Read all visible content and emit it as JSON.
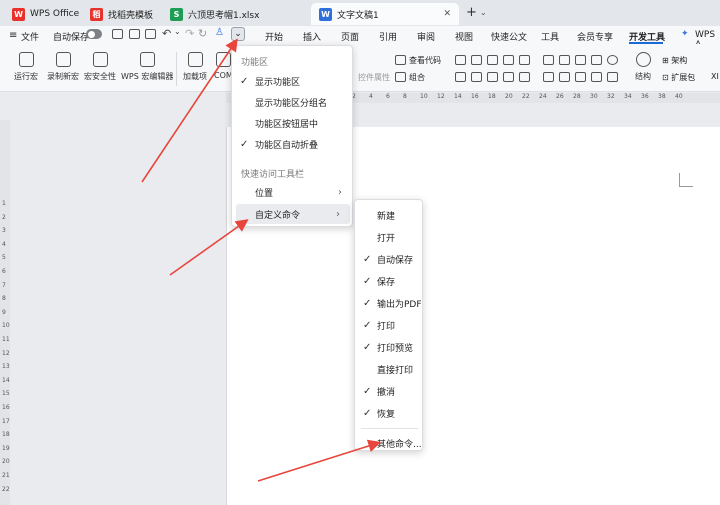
{
  "tabs": [
    {
      "label": "WPS Office",
      "icon": "wps-logo-icon",
      "color": "#e8312b"
    },
    {
      "label": "找稻壳模板",
      "icon": "docer-icon",
      "color": "#e8312b"
    },
    {
      "label": "六顶思考帽1.xlsx",
      "icon": "spreadsheet-icon",
      "color": "#1e9e55"
    },
    {
      "label": "文字文稿1",
      "icon": "writer-icon",
      "color": "#2f6fdb"
    }
  ],
  "new_tab": "+",
  "toolbar": {
    "file": "文件",
    "autosave": "自动保存"
  },
  "menu_tabs": [
    "开始",
    "插入",
    "页面",
    "引用",
    "审阅",
    "视图",
    "快速公文",
    "工具",
    "会员专享",
    "开发工具",
    "WPS A"
  ],
  "active_menu_tab": "开发工具",
  "ribbon": {
    "run_macro": "运行宏",
    "record_macro": "录制新宏",
    "macro_security": "宏安全性",
    "vba_editor": "WPS 宏编辑器",
    "addins": "加载项",
    "com": "COM",
    "control_props": "控件属性",
    "view_code": "查看代码",
    "combine": "组合",
    "structure": "结构",
    "arch": "架构",
    "ext_pack": "扩展包",
    "xml": "XI"
  },
  "dropdown1": {
    "section1": "功能区",
    "items": [
      {
        "label": "显示功能区",
        "checked": true
      },
      {
        "label": "显示功能区分组名",
        "checked": false
      },
      {
        "label": "功能区按钮居中",
        "checked": false
      },
      {
        "label": "功能区自动折叠",
        "checked": true
      }
    ],
    "section2": "快速访问工具栏",
    "position": "位置",
    "custom": "自定义命令"
  },
  "dropdown2": {
    "items": [
      {
        "label": "新建",
        "checked": false
      },
      {
        "label": "打开",
        "checked": false
      },
      {
        "label": "自动保存",
        "checked": true
      },
      {
        "label": "保存",
        "checked": true
      },
      {
        "label": "输出为PDF",
        "checked": true
      },
      {
        "label": "打印",
        "checked": true
      },
      {
        "label": "打印预览",
        "checked": true
      },
      {
        "label": "直接打印",
        "checked": false
      },
      {
        "label": "撤消",
        "checked": true
      },
      {
        "label": "恢复",
        "checked": true
      }
    ],
    "more": "其他命令..."
  },
  "ruler": {
    "marks": [
      "2",
      "4",
      "6",
      "8",
      "10",
      "12",
      "14",
      "16",
      "18",
      "20",
      "22",
      "24",
      "26",
      "28",
      "30",
      "32",
      "34",
      "36",
      "38",
      "40"
    ]
  },
  "vruler": {
    "marks": [
      "1",
      "2",
      "3",
      "4",
      "5",
      "6",
      "7",
      "8",
      "9",
      "10",
      "11",
      "12",
      "13",
      "14",
      "15",
      "16",
      "17",
      "18",
      "19",
      "20",
      "21",
      "22"
    ]
  },
  "colors": {
    "accent": "#1a6ad8",
    "arrow": "#e8453c"
  }
}
